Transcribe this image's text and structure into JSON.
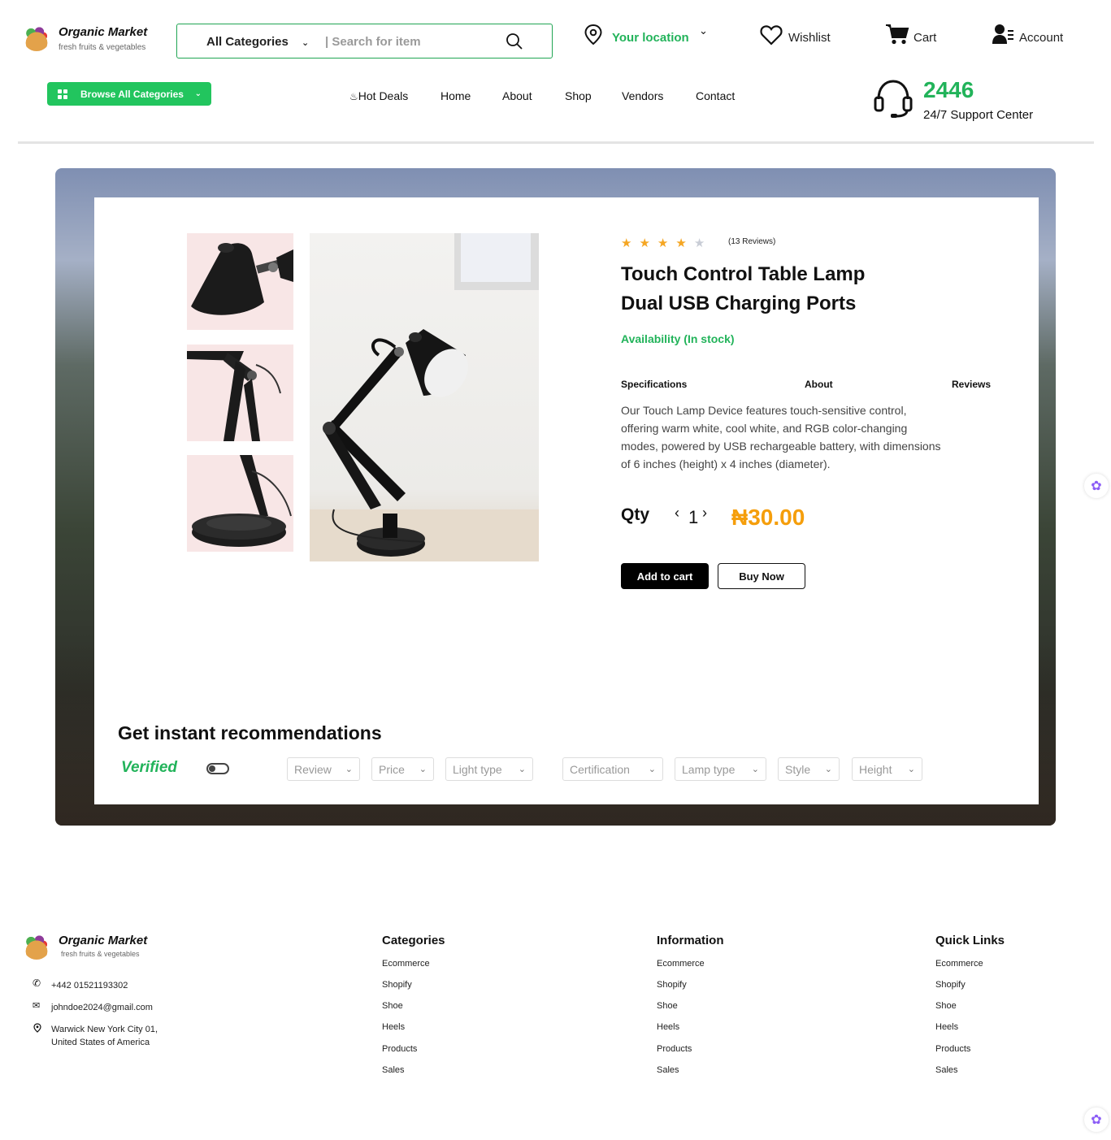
{
  "brand": {
    "name": "Organic Market",
    "tagline": "fresh fruits & vegetables"
  },
  "search": {
    "category": "All Categories",
    "placeholder": "| Search for item"
  },
  "header": {
    "location_label": "Your location",
    "wishlist_label": "Wishlist",
    "cart_label": "Cart",
    "account_label": "Account"
  },
  "nav": {
    "browse_label": "Browse All Categories",
    "items": [
      "Hot Deals",
      "Home",
      "About",
      "Shop",
      "Vendors",
      "Contact"
    ]
  },
  "support": {
    "number": "2446",
    "label": "24/7 Support Center"
  },
  "product": {
    "rating": 4,
    "rating_max": 5,
    "reviews": "(13 Reviews)",
    "title_line1": "Touch Control Table Lamp",
    "title_line2": "Dual USB Charging Ports",
    "availability": "Availability (In stock)",
    "tabs": [
      "Specifications",
      "About",
      "Reviews"
    ],
    "description": "Our Touch Lamp Device features touch-sensitive control, offering warm white, cool white, and RGB color-changing modes, powered by USB rechargeable battery, with dimensions of 6 inches (height) x 4 inches (diameter).",
    "qty_label": "Qty",
    "qty_value": "1",
    "price": "₦30.00",
    "add_to_cart": "Add to cart",
    "buy_now": "Buy Now"
  },
  "recommendations": {
    "title": "Get instant recommendations",
    "verified_label": "Verified",
    "filters": [
      "Review",
      "Price",
      "Light type",
      "Certification",
      "Lamp type",
      "Style",
      "Height"
    ]
  },
  "footer": {
    "phone": "+442 01521193302",
    "email": "johndoe2024@gmail.com",
    "address_line1": "Warwick New York City 01,",
    "address_line2": "United States of America",
    "columns": [
      {
        "title": "Categories",
        "links": [
          "Ecommerce",
          "Shopify",
          "Shoe",
          "Heels",
          "Products",
          "Sales"
        ]
      },
      {
        "title": "Information",
        "links": [
          "Ecommerce",
          "Shopify",
          "Shoe",
          "Heels",
          "Products",
          "Sales"
        ]
      },
      {
        "title": "Quick Links",
        "links": [
          "Ecommerce",
          "Shopify",
          "Shoe",
          "Heels",
          "Products",
          "Sales"
        ]
      }
    ]
  },
  "colors": {
    "accent": "#22b35a",
    "price": "#f59e0b",
    "star": "#f5a623"
  }
}
